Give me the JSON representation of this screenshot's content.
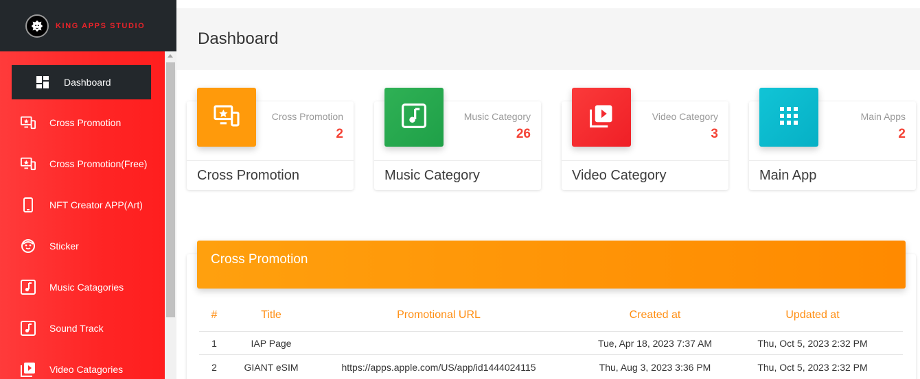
{
  "brand": {
    "name": "KING APPS STUDIO",
    "logo_icon": "lion-logo-icon"
  },
  "sidebar": {
    "items": [
      {
        "label": "Dashboard",
        "icon": "dashboard-icon",
        "active": true
      },
      {
        "label": "Cross Promotion",
        "icon": "monitor-star-icon"
      },
      {
        "label": "Cross Promotion(Free)",
        "icon": "monitor-star-icon"
      },
      {
        "label": "NFT Creator APP(Art)",
        "icon": "smartphone-icon"
      },
      {
        "label": "Sticker",
        "icon": "face-icon"
      },
      {
        "label": "Music Catagories",
        "icon": "music-note-icon"
      },
      {
        "label": "Sound Track",
        "icon": "music-note-icon"
      },
      {
        "label": "Video Catagories",
        "icon": "video-library-icon"
      }
    ]
  },
  "header": {
    "title": "Dashboard"
  },
  "cards": [
    {
      "category": "Cross Promotion",
      "count": "2",
      "footer": "Cross Promotion",
      "color": "#ff9a0b",
      "icon": "monitor-star-icon"
    },
    {
      "category": "Music Category",
      "count": "26",
      "footer": "Music Category",
      "color": "#2fb155",
      "icon": "music-note-icon"
    },
    {
      "category": "Video Category",
      "count": "3",
      "footer": "Video Category",
      "color": "#f7262f",
      "icon": "video-library-icon"
    },
    {
      "category": "Main Apps",
      "count": "2",
      "footer": "Main App",
      "color": "#0cbcd0",
      "icon": "apps-grid-icon"
    }
  ],
  "table": {
    "title": "Cross Promotion",
    "headers": [
      "#",
      "Title",
      "Promotional URL",
      "Created at",
      "Updated at"
    ],
    "rows": [
      [
        "1",
        "IAP Page",
        "",
        "Tue, Apr 18, 2023 7:37 AM",
        "Thu, Oct 5, 2023 2:32 PM"
      ],
      [
        "2",
        "GIANT eSIM",
        "https://apps.apple.com/US/app/id1444024115",
        "Thu, Aug 3, 2023 3:36 PM",
        "Thu, Oct 5, 2023 2:32 PM"
      ]
    ]
  },
  "colors": {
    "sidebar": "#ff2d2d",
    "brand_bg": "#23282c",
    "accent_orange": "#ff8e12",
    "count_red": "#f44336"
  }
}
